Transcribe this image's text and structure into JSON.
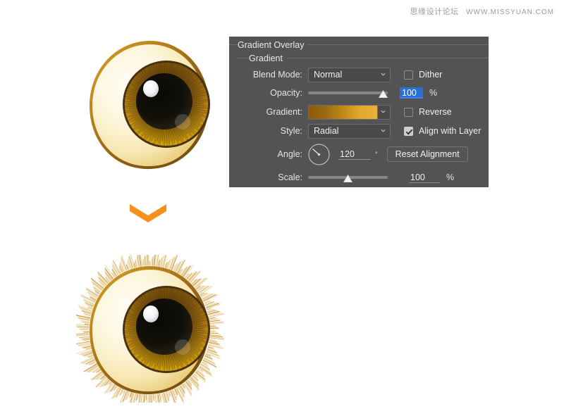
{
  "watermark": {
    "text": "思缘设计论坛",
    "url": "WWW.MISSYUAN.COM"
  },
  "panel": {
    "title": "Gradient Overlay",
    "subtitle": "Gradient",
    "rows": {
      "blend_mode": {
        "label": "Blend Mode:",
        "value": "Normal",
        "checkbox_label": "Dither",
        "checkbox_checked": false
      },
      "opacity": {
        "label": "Opacity:",
        "value": "100",
        "unit": "%",
        "slider_percent": 100
      },
      "gradient": {
        "label": "Gradient:",
        "checkbox_label": "Reverse",
        "checkbox_checked": false,
        "stops": [
          "#8a5a0c",
          "#9a6a10",
          "#c08a18",
          "#e0a92c",
          "#e8b13a"
        ]
      },
      "style": {
        "label": "Style:",
        "value": "Radial",
        "checkbox_label": "Align with Layer",
        "checkbox_checked": true
      },
      "angle": {
        "label": "Angle:",
        "value": "120",
        "unit": "°",
        "button_label": "Reset Alignment"
      },
      "scale": {
        "label": "Scale:",
        "value": "100",
        "unit": "%",
        "slider_percent": 50
      }
    }
  },
  "illustration": {
    "eye_top_caption": "eye-without-lashes",
    "eye_bottom_caption": "eye-with-lashes",
    "arrow_color": "#f7911e",
    "colors": {
      "sclera_light": "#fffdf4",
      "sclera_mid": "#f6e3a8",
      "rim_gold": "#c8941f",
      "rim_dark": "#8a5d12",
      "iris_dark": "#5d3a11",
      "iris_bright": "#ffd400",
      "pupil": "#100d06",
      "highlight": "#ffffff"
    }
  }
}
